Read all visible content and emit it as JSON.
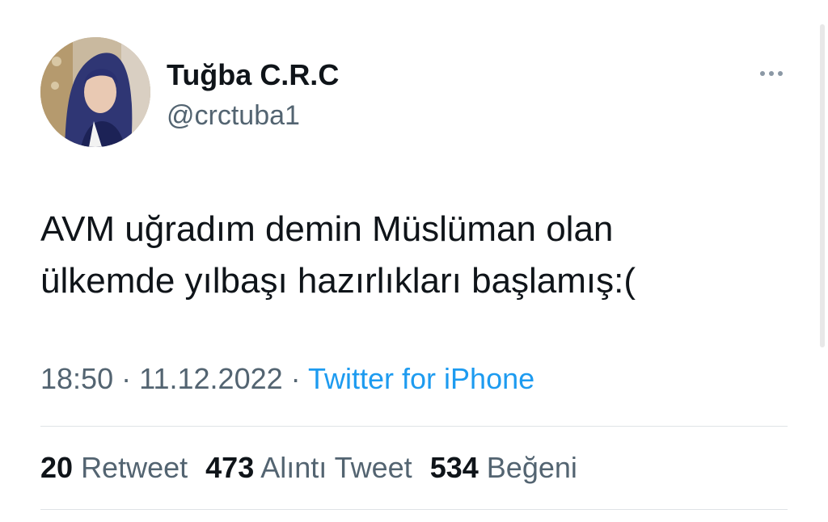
{
  "author": {
    "display_name": "Tuğba C.R.C",
    "handle": "@crctuba1"
  },
  "tweet": {
    "lines": [
      "AVM uğradım demin Müslüman olan",
      "ülkemde yılbaşı hazırlıkları başlamış:("
    ],
    "time": "18:50",
    "date": "11.12.2022",
    "separator": "·",
    "source": "Twitter for iPhone"
  },
  "stats": {
    "retweets_count": "20",
    "retweets_label": "Retweet",
    "quotes_count": "473",
    "quotes_label": "Alıntı Tweet",
    "likes_count": "534",
    "likes_label": "Beğeni"
  },
  "colors": {
    "text": "#0f1419",
    "secondary": "#536471",
    "link": "#1d9bf0",
    "divider": "#dfe3e6"
  },
  "icons": {
    "more": "more-horizontal-icon"
  }
}
